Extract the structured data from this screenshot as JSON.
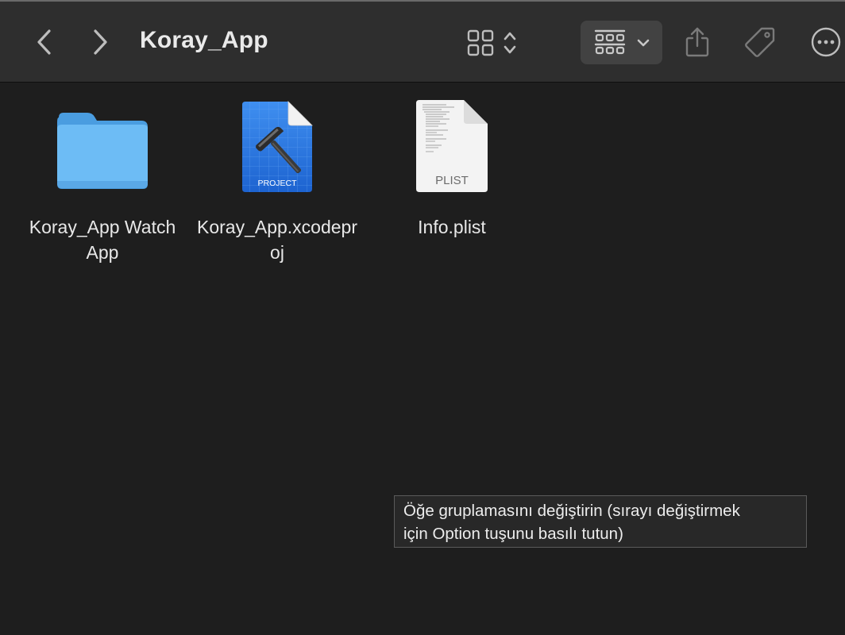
{
  "window": {
    "title": "Koray_App"
  },
  "toolbar": {
    "back_icon": "chevron-left-icon",
    "forward_icon": "chevron-right-icon",
    "view_icon": "icon-grid-view-icon",
    "group_icon": "group-by-icon",
    "share_icon": "share-icon",
    "tag_icon": "tag-icon",
    "more_icon": "ellipsis-circle-icon"
  },
  "files": [
    {
      "name": "Koray_App Watch App",
      "kind": "folder",
      "icon": "folder-icon"
    },
    {
      "name": "Koray_App.xcodeproj",
      "kind": "xcode-project",
      "icon": "xcode-project-icon",
      "badge": "PROJECT"
    },
    {
      "name": "Info.plist",
      "kind": "plist",
      "icon": "plist-document-icon",
      "badge": "PLIST"
    }
  ],
  "tooltip": {
    "line1": "Öğe gruplamasını değiştirin (sırayı değiştirmek",
    "line2": "için Option tuşunu basılı tutun)"
  },
  "colors": {
    "background": "#1e1e1e",
    "toolbar": "#2e2e2e",
    "folder": "#64b5f0",
    "xcode_blue": "#2f7de1"
  }
}
